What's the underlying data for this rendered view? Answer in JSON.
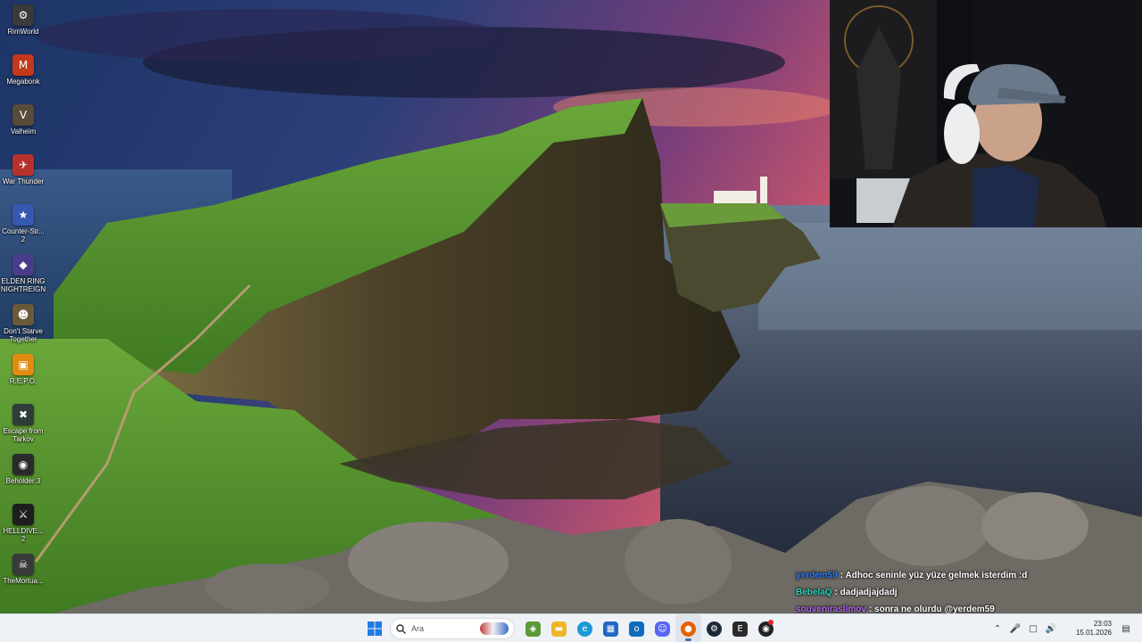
{
  "desktop": {
    "icons": [
      {
        "label": "RimWorld",
        "icon": "rimworld-icon",
        "glyph": "⚙",
        "color": "#3a3a3a"
      },
      {
        "label": "Megabonk",
        "icon": "megabonk-icon",
        "glyph": "M",
        "color": "#c2391b"
      },
      {
        "label": "Valheim",
        "icon": "valheim-icon",
        "glyph": "V",
        "color": "#5a4a38"
      },
      {
        "label": "War Thunder",
        "icon": "war-thunder-icon",
        "glyph": "✈",
        "color": "#b8322c"
      },
      {
        "label": "Counter-Str... 2",
        "icon": "counter-strike-icon",
        "glyph": "★",
        "color": "#3558b0"
      },
      {
        "label": "ELDEN RING NIGHTREIGN",
        "icon": "elden-ring-icon",
        "glyph": "◆",
        "color": "#4a3c8a"
      },
      {
        "label": "Don't Starve Together",
        "icon": "dont-starve-icon",
        "glyph": "☻",
        "color": "#6b5a3a"
      },
      {
        "label": "R.E.P.O.",
        "icon": "repo-icon",
        "glyph": "▣",
        "color": "#e08a10"
      },
      {
        "label": "Escape from Tarkov",
        "icon": "tarkov-icon",
        "glyph": "✖",
        "color": "#2f3d3a"
      },
      {
        "label": "Beholder 3",
        "icon": "beholder-icon",
        "glyph": "◉",
        "color": "#2a2a2a"
      },
      {
        "label": "HELLDIVE... 2",
        "icon": "helldivers-icon",
        "glyph": "⚔",
        "color": "#1e1e1e"
      },
      {
        "label": "TheMortua...",
        "icon": "mortuary-icon",
        "glyph": "☠",
        "color": "#3a3a3a"
      }
    ]
  },
  "chat": {
    "messages": [
      {
        "user": "yerdem59",
        "user_color": "#2f7fff",
        "text": ": Adhoc seninle yüz yüze gelmek isterdim :d"
      },
      {
        "user": "BebelaQ",
        "user_color": "#2bd4c0",
        "text": ": dadjadjajdadj"
      },
      {
        "user": "souveniraslimov",
        "user_color": "#b06ae8",
        "text": ": sonra ne olurdu @yerdem59"
      }
    ]
  },
  "taskbar": {
    "search_placeholder": "Ara",
    "apps": [
      {
        "name": "chrome-like-app-icon",
        "glyph": "◈",
        "color": "#5b9a3a"
      },
      {
        "name": "file-explorer-icon",
        "glyph": "▬",
        "color": "#f0b429"
      },
      {
        "name": "edge-browser-icon",
        "glyph": "e",
        "color": "#1a9ad6"
      },
      {
        "name": "microsoft-store-icon",
        "glyph": "▦",
        "color": "#2266c4"
      },
      {
        "name": "outlook-icon",
        "glyph": "o",
        "color": "#0f6cbd"
      },
      {
        "name": "discord-icon",
        "glyph": "☺",
        "color": "#5865f2"
      },
      {
        "name": "firefox-icon",
        "glyph": "●",
        "color": "#e66000",
        "active": true
      },
      {
        "name": "steam-icon",
        "glyph": "⚙",
        "color": "#1b2838"
      },
      {
        "name": "epic-games-icon",
        "glyph": "E",
        "color": "#2a2a2a"
      },
      {
        "name": "obs-icon",
        "glyph": "◉",
        "color": "#222222",
        "notify": true
      }
    ],
    "time": "23:03",
    "date": "15.01.2026"
  }
}
